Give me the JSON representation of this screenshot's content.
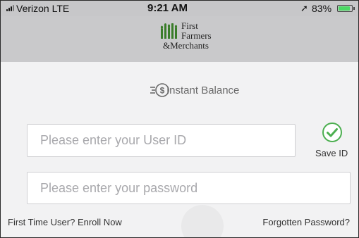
{
  "status_bar": {
    "carrier": "Verizon  LTE",
    "time": "9:21 AM",
    "battery_percent": "83%",
    "battery_level": 0.83,
    "icons": [
      "signal-icon",
      "location-arrow-icon",
      "battery-icon"
    ]
  },
  "logo": {
    "line1": "First",
    "line2": "Farmers",
    "line3": "&Merchants"
  },
  "instant_balance": {
    "label": "Instant Balance",
    "icon": "dollar-speed-icon"
  },
  "login": {
    "user_id_placeholder": "Please enter your User ID",
    "user_id_value": "",
    "password_placeholder": "Please enter your password",
    "password_value": "",
    "save_id_label": "Save ID",
    "save_id_checked": true
  },
  "links": {
    "enroll": "First Time User? Enroll Now",
    "forgot": "Forgotten Password?"
  },
  "colors": {
    "status_bar_bg": "#c7c7c9",
    "header_bg": "#c9c9cb",
    "body_bg": "#f2f2f3",
    "brand_green": "#3a7d2a",
    "check_green": "#4caf50",
    "battery_green": "#4cd964"
  }
}
